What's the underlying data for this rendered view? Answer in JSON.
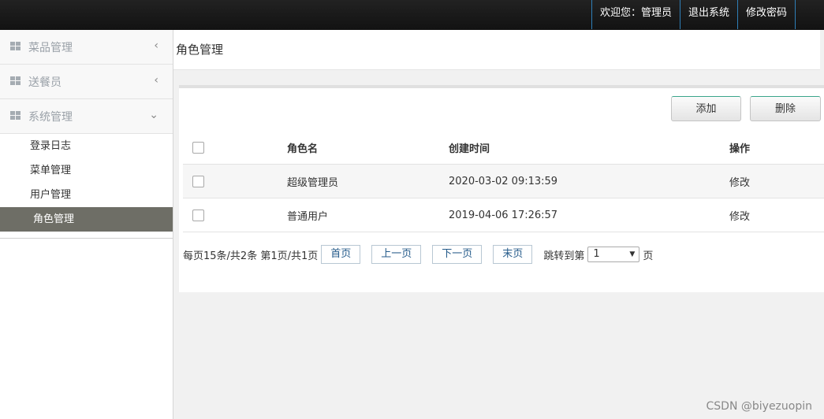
{
  "topbar": {
    "welcome": "欢迎您：管理员",
    "logout": "退出系统",
    "change_password": "修改密码"
  },
  "sidebar": {
    "menus": [
      {
        "label": "菜品管理",
        "arrow": "‹"
      },
      {
        "label": "送餐员",
        "arrow": "‹"
      },
      {
        "label": "系统管理",
        "arrow": "⌄"
      }
    ],
    "sub_items": [
      "登录日志",
      "菜单管理",
      "用户管理",
      "角色管理"
    ]
  },
  "page": {
    "title": "角色管理"
  },
  "toolbar": {
    "add_label": "添加",
    "delete_label": "删除"
  },
  "table": {
    "headers": [
      "角色名",
      "创建时间",
      "操作"
    ],
    "rows": [
      {
        "name": "超级管理员",
        "created": "2020-03-02 09:13:59",
        "action": "修改"
      },
      {
        "name": "普通用户",
        "created": "2019-04-06 17:26:57",
        "action": "修改"
      }
    ]
  },
  "pager": {
    "summary": "每页15条/共2条 第1页/共1页",
    "first": "首页",
    "prev": "上一页",
    "next": "下一页",
    "last": "末页",
    "jump_prefix": "跳转到第",
    "jump_value": "1",
    "jump_suffix": "页"
  },
  "watermark": "CSDN @biyezuopin"
}
